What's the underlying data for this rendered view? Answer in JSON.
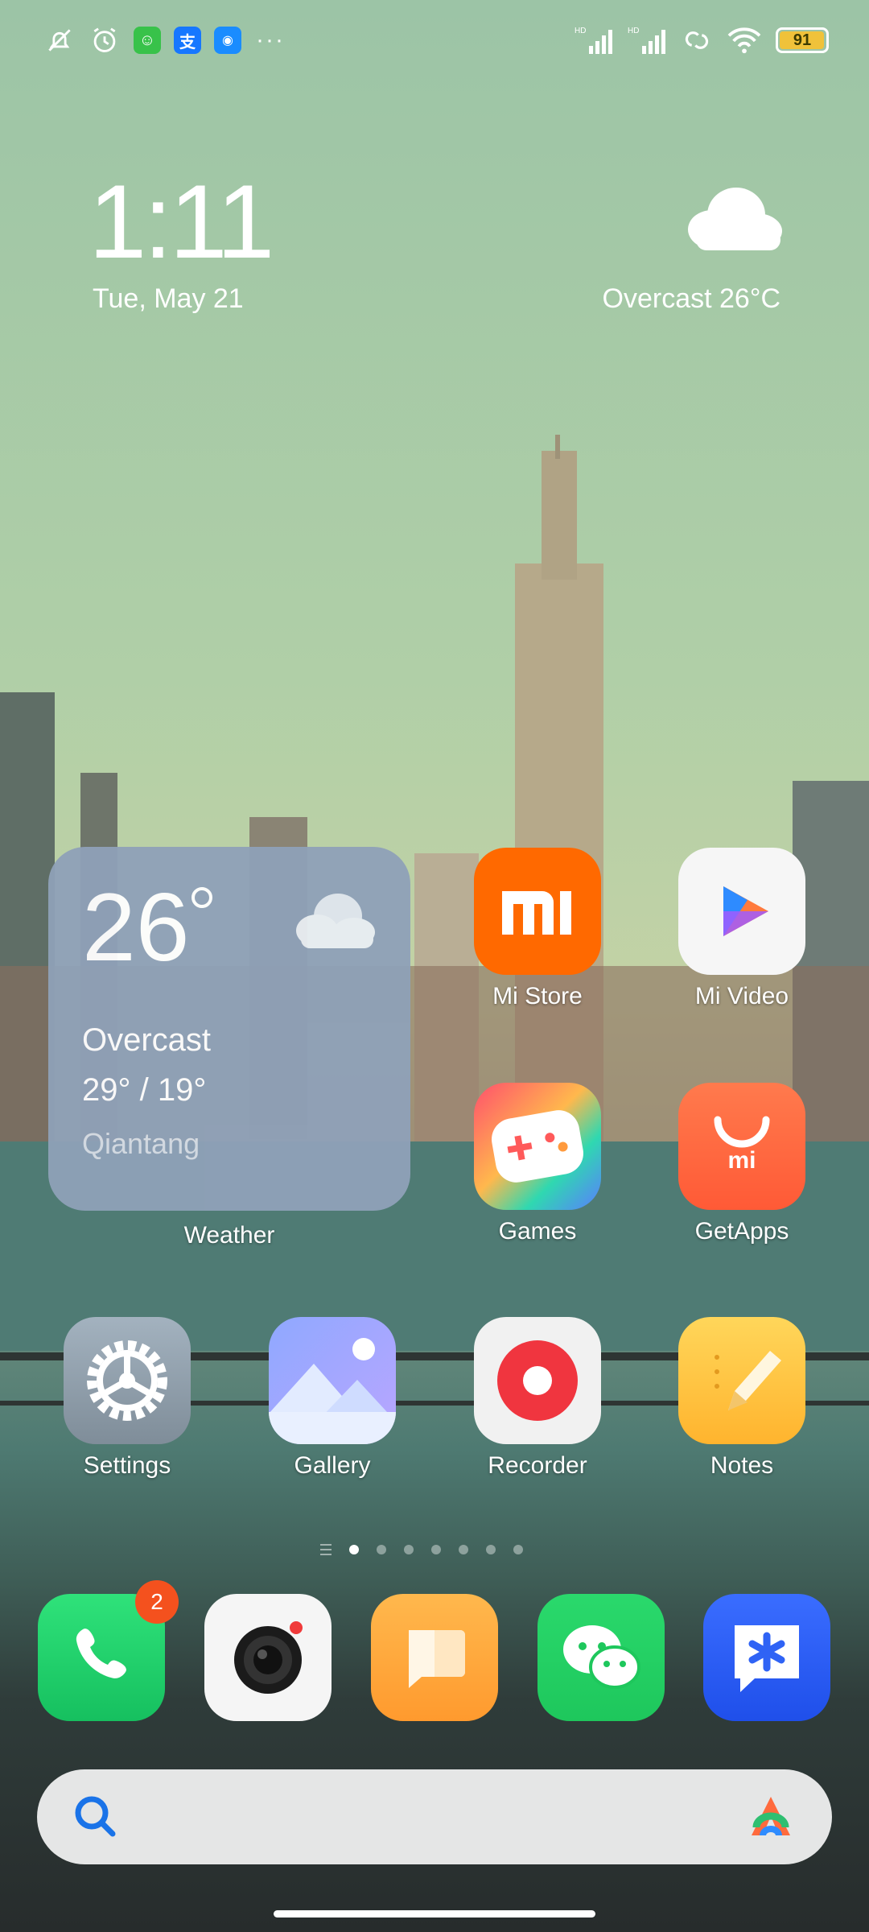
{
  "status_bar": {
    "battery_level": "91",
    "network_labels": [
      "HD",
      "HD"
    ]
  },
  "clock_widget": {
    "time": "1:11",
    "date": "Tue, May 21",
    "weather_summary": "Overcast 26°C"
  },
  "weather_widget": {
    "temperature": "26",
    "condition": "Overcast",
    "range": "29° / 19°",
    "city": "Qiantang",
    "label": "Weather"
  },
  "apps": {
    "mi_store": "Mi Store",
    "mi_video": "Mi Video",
    "games": "Games",
    "getapps": "GetApps",
    "settings": "Settings",
    "gallery": "Gallery",
    "recorder": "Recorder",
    "notes": "Notes"
  },
  "dock": {
    "phone_badge": "2"
  },
  "page_indicator": {
    "total_pages": 8,
    "active_page": 1
  },
  "colors": {
    "mi_orange": "#ff6900",
    "battery": "#f0c23a",
    "wechat_green": "#1ec75c",
    "badge_red": "#f4511e"
  }
}
